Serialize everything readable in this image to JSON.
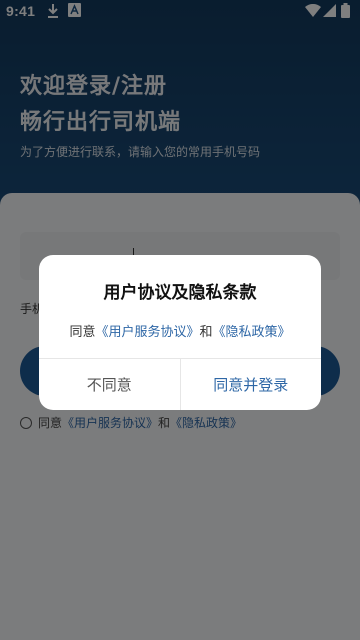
{
  "status_bar": {
    "time": "9:41",
    "icons": [
      "download-icon",
      "font-a-icon",
      "wifi-icon",
      "signal-icon",
      "battery-icon"
    ]
  },
  "hero": {
    "title_line1": "欢迎登录/注册",
    "title_line2": "畅行出行司机端",
    "subtitle": "为了方便进行联系，请输入您的常用手机号码"
  },
  "form": {
    "phone_label": "手机",
    "agreement_prefix": "同意",
    "agreement_user": "《用户服务协议》",
    "agreement_and": "和",
    "agreement_privacy": "《隐私政策》"
  },
  "dialog": {
    "title": "用户协议及隐私条款",
    "body_prefix": "同意",
    "body_user": "《用户服务协议》",
    "body_and": "和",
    "body_privacy": "《隐私政策》",
    "cancel_label": "不同意",
    "confirm_label": "同意并登录"
  },
  "colors": {
    "hero": "#1c4f7e",
    "primary": "#1d5a96",
    "link": "#2e67a6",
    "scrim": "rgba(0,0,0,0.5)"
  }
}
